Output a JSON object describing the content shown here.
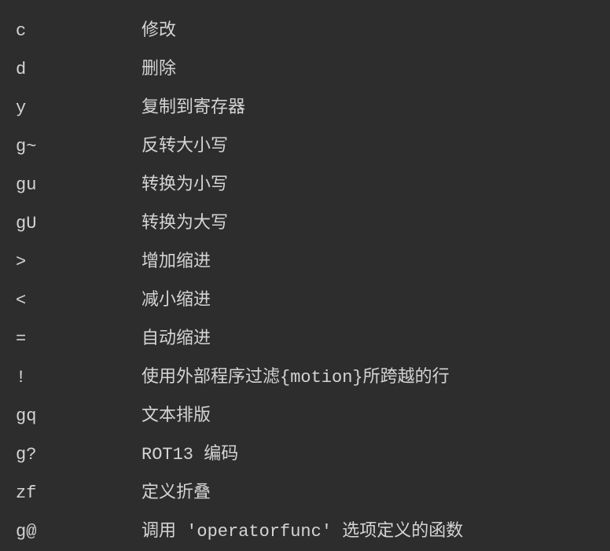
{
  "operators": [
    {
      "command": "c",
      "description": "修改"
    },
    {
      "command": "d",
      "description": "删除"
    },
    {
      "command": "y",
      "description": "复制到寄存器"
    },
    {
      "command": "g~",
      "description": "反转大小写"
    },
    {
      "command": "gu",
      "description": "转换为小写"
    },
    {
      "command": "gU",
      "description": "转换为大写"
    },
    {
      "command": ">",
      "description": "增加缩进"
    },
    {
      "command": "<",
      "description": "减小缩进"
    },
    {
      "command": "=",
      "description": "自动缩进"
    },
    {
      "command": "!",
      "description": "使用外部程序过滤{motion}所跨越的行"
    },
    {
      "command": "gq",
      "description": "文本排版"
    },
    {
      "command": "g?",
      "description": "ROT13 编码"
    },
    {
      "command": "zf",
      "description": "定义折叠"
    },
    {
      "command": "g@",
      "description": "调用 'operatorfunc' 选项定义的函数"
    }
  ]
}
